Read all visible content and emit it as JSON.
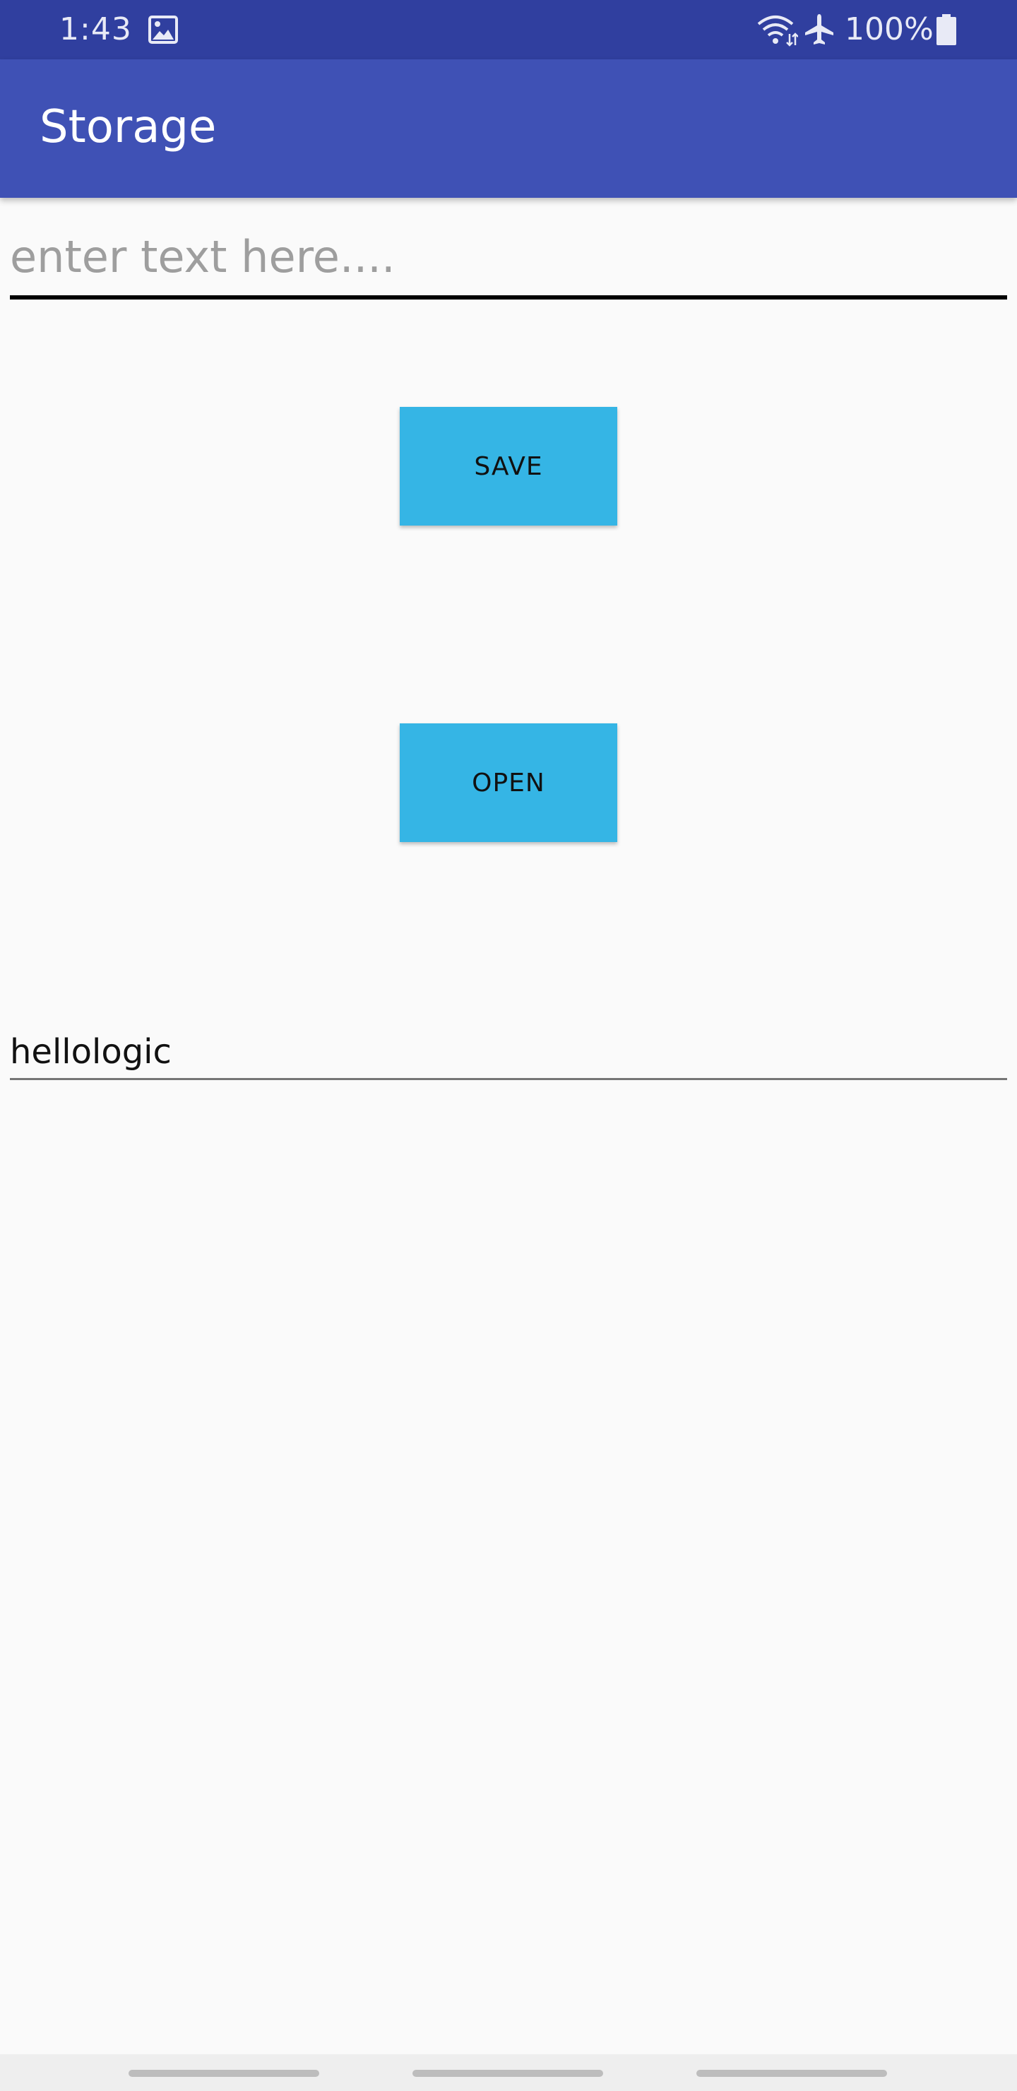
{
  "status_bar": {
    "time": "1:43",
    "battery_level": "100%",
    "icons": [
      "gallery-icon",
      "wifi-icon",
      "airplane-icon",
      "battery-icon"
    ]
  },
  "app_bar": {
    "title": "Storage"
  },
  "input": {
    "placeholder": "enter text here....",
    "value": ""
  },
  "buttons": {
    "save_label": "SAVE",
    "open_label": "OPEN"
  },
  "output": {
    "text": "hellologic"
  },
  "colors": {
    "status_bar": "#303f9f",
    "app_bar": "#3f51b5",
    "button": "#35b5e5",
    "background": "#fafafa"
  }
}
